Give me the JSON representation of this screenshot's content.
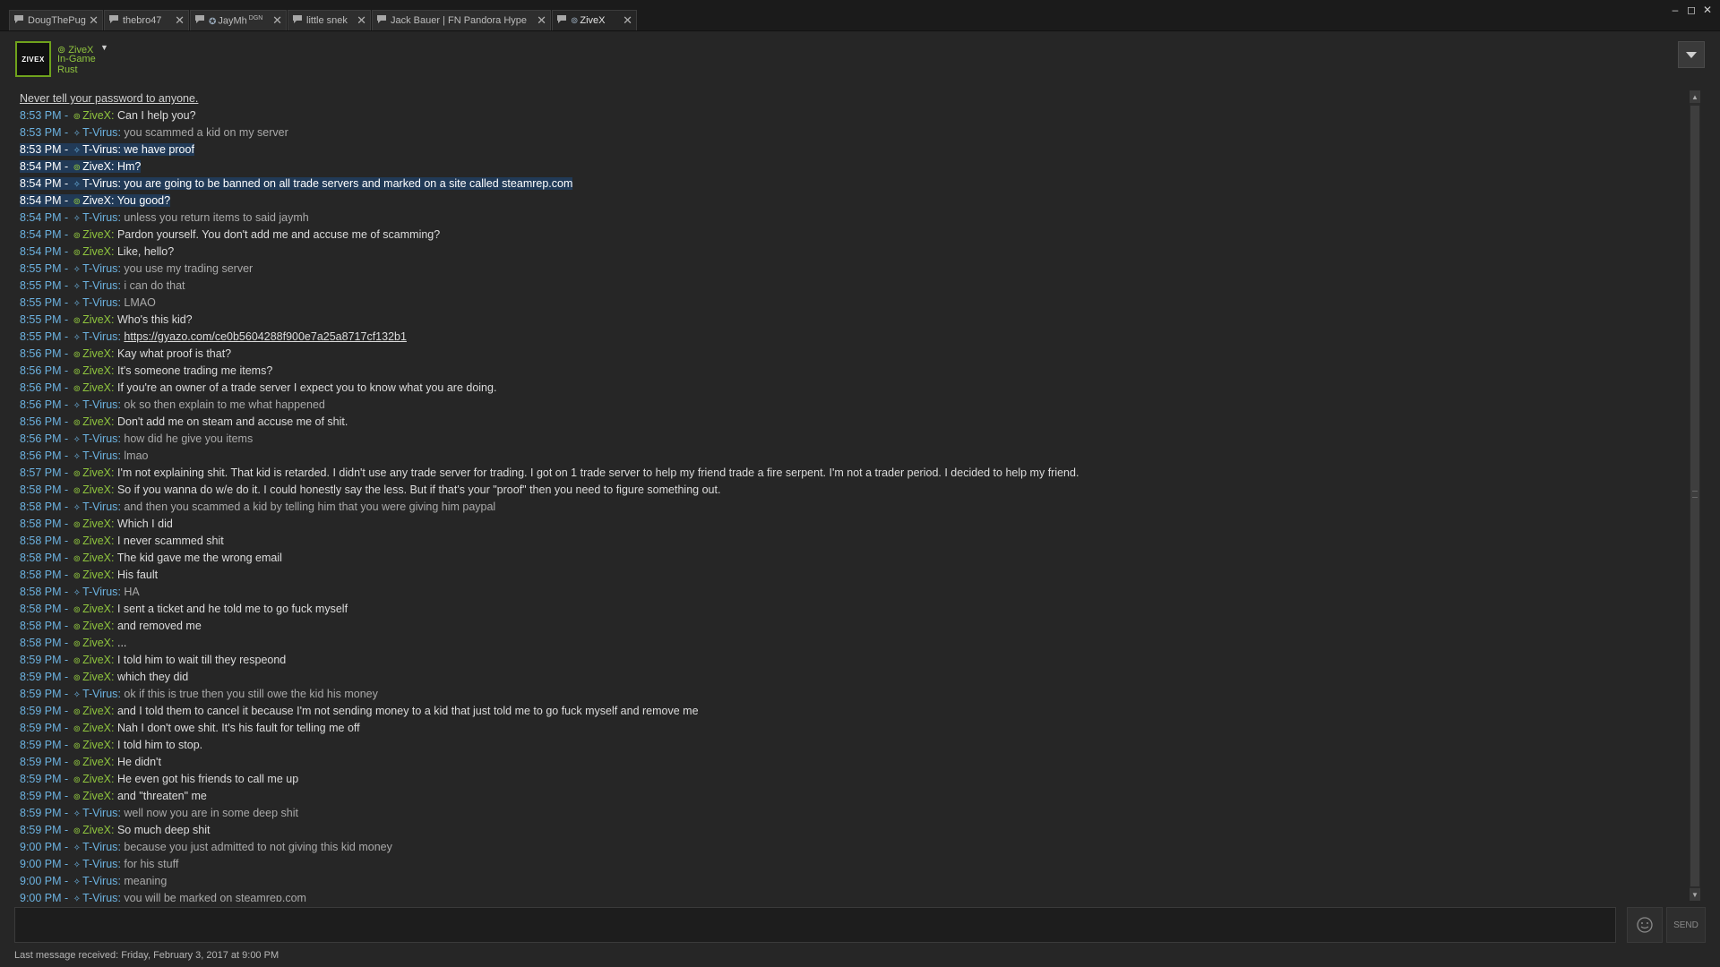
{
  "tabs": [
    {
      "label": "DougThePug",
      "width": 105,
      "active": false
    },
    {
      "label": "thebro47",
      "width": 95,
      "active": false
    },
    {
      "label": "JayMh",
      "badge": "DGN",
      "width": 108,
      "active": false
    },
    {
      "label": "little snek",
      "width": 93,
      "active": false
    },
    {
      "label": "Jack Bauer | FN Pandora Hype",
      "width": 200,
      "active": false
    },
    {
      "label": "ZiveX",
      "width": 95,
      "active": true
    }
  ],
  "window": {
    "minimize": "–",
    "maximize": "◻",
    "close": "✕"
  },
  "header": {
    "avatar_text": "ZIVEX",
    "name": "ZiveX",
    "status": "In-Game",
    "game": "Rust"
  },
  "chat": {
    "notice": "Never tell your password to anyone.",
    "messages": [
      {
        "time": "8:53 PM",
        "sender": "ZiveX",
        "text": "Can I help you?"
      },
      {
        "time": "8:53 PM",
        "sender": "T-Virus",
        "text": "you scammed a kid on my server"
      },
      {
        "time": "8:53 PM",
        "sender": "T-Virus",
        "text": "we have proof",
        "selected": true
      },
      {
        "time": "8:54 PM",
        "sender": "ZiveX",
        "text": "Hm?",
        "selected": true
      },
      {
        "time": "8:54 PM",
        "sender": "T-Virus",
        "text": "you are going to be banned on all trade servers and marked on a site called steamrep.com",
        "selected": true
      },
      {
        "time": "8:54 PM",
        "sender": "ZiveX",
        "text": "You good?",
        "selected": true
      },
      {
        "time": "8:54 PM",
        "sender": "T-Virus",
        "text": "unless you return items to said jaymh"
      },
      {
        "time": "8:54 PM",
        "sender": "ZiveX",
        "text": "Pardon yourself. You don't add me and accuse me of scamming?"
      },
      {
        "time": "8:54 PM",
        "sender": "ZiveX",
        "text": "Like, hello?"
      },
      {
        "time": "8:55 PM",
        "sender": "T-Virus",
        "text": "you use my trading server"
      },
      {
        "time": "8:55 PM",
        "sender": "T-Virus",
        "text": "i can do that"
      },
      {
        "time": "8:55 PM",
        "sender": "T-Virus",
        "text": "LMAO"
      },
      {
        "time": "8:55 PM",
        "sender": "ZiveX",
        "text": "Who's this kid?"
      },
      {
        "time": "8:55 PM",
        "sender": "T-Virus",
        "text": "https://gyazo.com/ce0b5604288f900e7a25a8717cf132b1",
        "link": true
      },
      {
        "time": "8:56 PM",
        "sender": "ZiveX",
        "text": "Kay what proof is that?"
      },
      {
        "time": "8:56 PM",
        "sender": "ZiveX",
        "text": "It's someone trading me items?"
      },
      {
        "time": "8:56 PM",
        "sender": "ZiveX",
        "text": "If you're an owner of a trade server I expect you to know what you are doing."
      },
      {
        "time": "8:56 PM",
        "sender": "T-Virus",
        "text": "ok so then explain to me what happened"
      },
      {
        "time": "8:56 PM",
        "sender": "ZiveX",
        "text": "Don't add me on steam and accuse me of shit."
      },
      {
        "time": "8:56 PM",
        "sender": "T-Virus",
        "text": "how did he give you items"
      },
      {
        "time": "8:56 PM",
        "sender": "T-Virus",
        "text": "lmao"
      },
      {
        "time": "8:57 PM",
        "sender": "ZiveX",
        "text": "I'm not explaining shit. That kid is retarded. I didn't use any trade server for trading. I got on 1 trade server to help my friend trade a fire serpent. I'm not a trader period. I decided to help my friend."
      },
      {
        "time": "8:58 PM",
        "sender": "ZiveX",
        "text": "So if you wanna do w/e do it. I could honestly say the less. But if that's your \"proof\" then you need to figure something out."
      },
      {
        "time": "8:58 PM",
        "sender": "T-Virus",
        "text": "and then you scammed a kid by telling him that you were giving him paypal"
      },
      {
        "time": "8:58 PM",
        "sender": "ZiveX",
        "text": "Which I did"
      },
      {
        "time": "8:58 PM",
        "sender": "ZiveX",
        "text": "I never scammed shit"
      },
      {
        "time": "8:58 PM",
        "sender": "ZiveX",
        "text": "The kid gave me the wrong email"
      },
      {
        "time": "8:58 PM",
        "sender": "ZiveX",
        "text": "His fault"
      },
      {
        "time": "8:58 PM",
        "sender": "T-Virus",
        "text": "HA"
      },
      {
        "time": "8:58 PM",
        "sender": "ZiveX",
        "text": "I sent a ticket and he told me to go fuck myself"
      },
      {
        "time": "8:58 PM",
        "sender": "ZiveX",
        "text": "and removed me"
      },
      {
        "time": "8:58 PM",
        "sender": "ZiveX",
        "text": "..."
      },
      {
        "time": "8:59 PM",
        "sender": "ZiveX",
        "text": "I told him to wait till they respeond"
      },
      {
        "time": "8:59 PM",
        "sender": "ZiveX",
        "text": "which they did"
      },
      {
        "time": "8:59 PM",
        "sender": "T-Virus",
        "text": "ok if this is true then you still owe the kid his money"
      },
      {
        "time": "8:59 PM",
        "sender": "ZiveX",
        "text": "and I told them to cancel it because I'm not sending money to a kid that just told me to go fuck myself and remove me"
      },
      {
        "time": "8:59 PM",
        "sender": "ZiveX",
        "text": "Nah I don't owe shit. It's his fault for telling me off"
      },
      {
        "time": "8:59 PM",
        "sender": "ZiveX",
        "text": "I told him to stop."
      },
      {
        "time": "8:59 PM",
        "sender": "ZiveX",
        "text": "He didn't"
      },
      {
        "time": "8:59 PM",
        "sender": "ZiveX",
        "text": "He even got his friends to call me up"
      },
      {
        "time": "8:59 PM",
        "sender": "ZiveX",
        "text": "and \"threaten\" me"
      },
      {
        "time": "8:59 PM",
        "sender": "T-Virus",
        "text": "well now you are in some deep shit"
      },
      {
        "time": "8:59 PM",
        "sender": "ZiveX",
        "text": "So much deep shit"
      },
      {
        "time": "9:00 PM",
        "sender": "T-Virus",
        "text": "because you just admitted to not giving this kid money"
      },
      {
        "time": "9:00 PM",
        "sender": "T-Virus",
        "text": "for his stuff"
      },
      {
        "time": "9:00 PM",
        "sender": "T-Virus",
        "text": "meaning"
      },
      {
        "time": "9:00 PM",
        "sender": "T-Virus",
        "text": "you will be marked on steamrep.com"
      }
    ]
  },
  "input": {
    "value": "",
    "send_label": "SEND"
  },
  "status_text": "Last message received: Friday, February 3, 2017 at 9:00 PM",
  "colors": {
    "accent_green": "#8fc43e",
    "accent_blue": "#6cb2e0",
    "background": "#262626",
    "selection": "#213a57"
  }
}
